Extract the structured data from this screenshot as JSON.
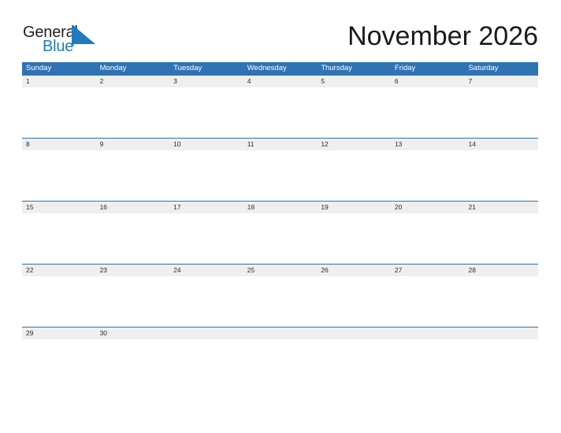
{
  "brand": {
    "line1": "General",
    "line2": "Blue",
    "flag_icon": "blue-triangle-flag-icon",
    "color_text": "#231f20",
    "color_blue": "#1f7ac0"
  },
  "header": {
    "title": "November 2026",
    "month": "November",
    "year": "2026"
  },
  "colors": {
    "header_blue": "#2f73b4",
    "date_band_gray": "#efefef",
    "grid_line_blue": "#2f73b4",
    "text_dark": "#1a1a1a"
  },
  "calendar": {
    "weekdays": [
      "Sunday",
      "Monday",
      "Tuesday",
      "Wednesday",
      "Thursday",
      "Friday",
      "Saturday"
    ],
    "weeks": [
      {
        "days": [
          {
            "date": "1"
          },
          {
            "date": "2"
          },
          {
            "date": "3"
          },
          {
            "date": "4"
          },
          {
            "date": "5"
          },
          {
            "date": "6"
          },
          {
            "date": "7"
          }
        ]
      },
      {
        "days": [
          {
            "date": "8"
          },
          {
            "date": "9"
          },
          {
            "date": "10"
          },
          {
            "date": "11"
          },
          {
            "date": "12"
          },
          {
            "date": "13"
          },
          {
            "date": "14"
          }
        ]
      },
      {
        "days": [
          {
            "date": "15"
          },
          {
            "date": "16"
          },
          {
            "date": "17"
          },
          {
            "date": "18"
          },
          {
            "date": "19"
          },
          {
            "date": "20"
          },
          {
            "date": "21"
          }
        ]
      },
      {
        "days": [
          {
            "date": "22"
          },
          {
            "date": "23"
          },
          {
            "date": "24"
          },
          {
            "date": "25"
          },
          {
            "date": "26"
          },
          {
            "date": "27"
          },
          {
            "date": "28"
          }
        ]
      },
      {
        "days": [
          {
            "date": "29"
          },
          {
            "date": "30"
          },
          {
            "date": ""
          },
          {
            "date": ""
          },
          {
            "date": ""
          },
          {
            "date": ""
          },
          {
            "date": ""
          }
        ]
      }
    ]
  }
}
